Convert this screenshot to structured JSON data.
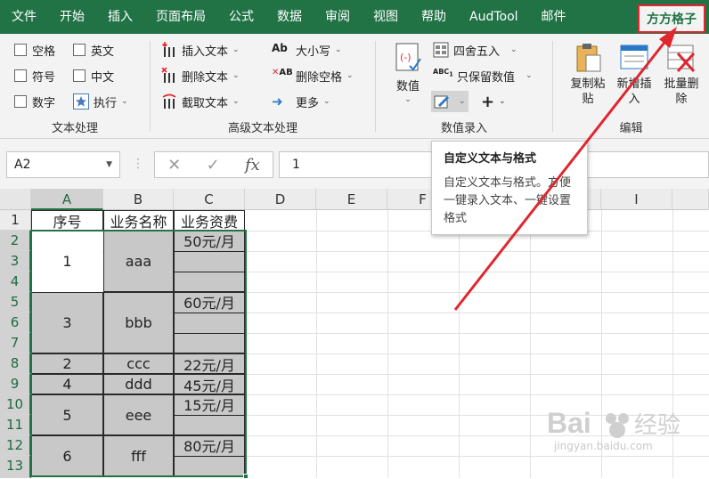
{
  "tabs": [
    {
      "label": "文件"
    },
    {
      "label": "开始"
    },
    {
      "label": "插入"
    },
    {
      "label": "页面布局"
    },
    {
      "label": "公式"
    },
    {
      "label": "数据"
    },
    {
      "label": "审阅"
    },
    {
      "label": "视图"
    },
    {
      "label": "帮助"
    },
    {
      "label": "AudTool"
    },
    {
      "label": "邮件"
    },
    {
      "label": "方方格子"
    }
  ],
  "ribbon": {
    "text_group": {
      "label": "文本处理",
      "checkboxes": [
        "空格",
        "英文",
        "符号",
        "中文",
        "数字"
      ],
      "execute": "执行"
    },
    "adv_group": {
      "label": "高级文本处理",
      "insert_text": "插入文本",
      "delete_text": "删除文本",
      "cut_text": "截取文本",
      "case": "大小写",
      "delete_space": "删除空格",
      "more": "更多"
    },
    "num_group": {
      "label": "数值录入",
      "value_btn": "数值",
      "round": "四舍五入",
      "keep_value": "只保留数值"
    },
    "edit_group": {
      "label": "编辑",
      "copy_paste": "复制粘贴",
      "add_insert": "新增插入",
      "batch_delete": "批量删除"
    }
  },
  "formula_bar": {
    "name_box": "A2",
    "cancel": "✕",
    "confirm": "✓",
    "fx": "fx",
    "formula": "1"
  },
  "grid": {
    "columns": [
      "A",
      "B",
      "C",
      "D",
      "E",
      "F",
      "G",
      "H",
      "I"
    ],
    "rows": [
      "1",
      "2",
      "3",
      "4",
      "5",
      "6",
      "7",
      "8",
      "9",
      "10",
      "11",
      "12",
      "13"
    ],
    "header_row": {
      "a": "序号",
      "b": "业务名称",
      "c": "业务资费"
    },
    "records": [
      {
        "seq": "1",
        "name": "aaa",
        "fee": "50元/月"
      },
      {
        "seq": "3",
        "name": "bbb",
        "fee": "60元/月"
      },
      {
        "seq": "2",
        "name": "ccc",
        "fee": "22元/月"
      },
      {
        "seq": "4",
        "name": "ddd",
        "fee": "45元/月"
      },
      {
        "seq": "5",
        "name": "eee",
        "fee": "15元/月"
      },
      {
        "seq": "6",
        "name": "fff",
        "fee": "80元/月"
      }
    ]
  },
  "tooltip": {
    "title": "自定义文本与格式",
    "body": "自定义文本与格式。方便一键录入文本、一键设置格式"
  },
  "watermark": {
    "brand": "Bai",
    "suffix": "经验",
    "url": "jingyan.baidu.com"
  },
  "colors": {
    "excel_green": "#217346",
    "arrow_red": "#e0262e",
    "merged_gray": "#c8c8c8"
  }
}
